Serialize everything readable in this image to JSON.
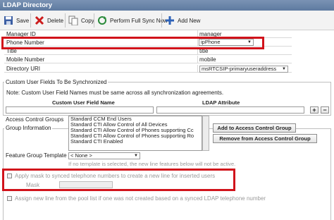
{
  "window": {
    "title": "LDAP Directory"
  },
  "toolbar": {
    "save": "Save",
    "delete": "Delete",
    "copy": "Copy",
    "sync": "Perform Full Sync Now",
    "add_new": "Add New"
  },
  "attributes": [
    {
      "label": "Manager ID",
      "value": "manager"
    },
    {
      "label": "Phone Number",
      "value": "ipPhone"
    },
    {
      "label": "Title",
      "value": "title"
    },
    {
      "label": "Mobile Number",
      "value": "mobile"
    },
    {
      "label": "Directory URI",
      "value": "msRTCSIP-primaryuseraddress"
    }
  ],
  "custom_fields": {
    "heading": "Custom User Fields To Be Synchronized",
    "note": "Note: Custom User Field Names must be same across all synchronization agreements.",
    "col1": "Custom User Field Name",
    "col2": "LDAP Attribute",
    "add": "+",
    "remove": "−"
  },
  "group_info": {
    "heading": "Group Information",
    "acg_label": "Access Control Groups",
    "acg_items": [
      "Standard CCM End Users",
      "Standard CTI Allow Control of All Devices",
      "Standard CTI Allow Control of Phones supporting Cc",
      "Standard CTI Allow Control of Phones supporting Ro",
      "Standard CTI Enabled"
    ],
    "add_btn": "Add to Access Control Group",
    "remove_btn": "Remove from Access Control Group",
    "fgt_label": "Feature Group Template",
    "fgt_value": "< None >",
    "warning": "If no template is selected, the new line features below will not be active.",
    "apply_mask_label": "Apply mask to synced telephone numbers to create a new line for inserted users",
    "mask_label": "Mask",
    "assign_label": "Assign new line from the pool list if one was not created based on a synced LDAP telephone number"
  },
  "colors": {
    "highlight": "#d1131b",
    "titlebar": "#6a84a8"
  }
}
